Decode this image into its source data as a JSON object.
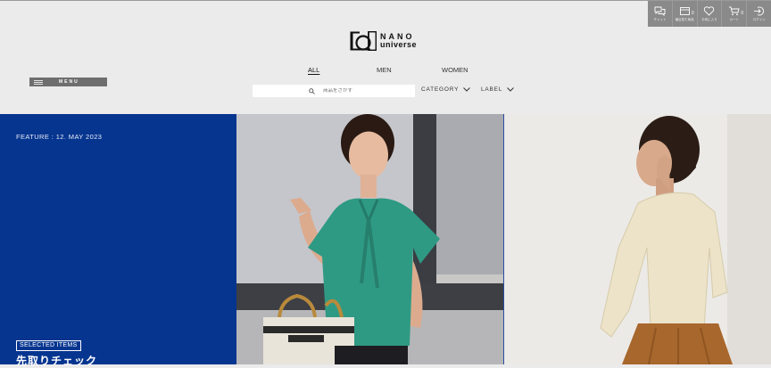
{
  "brand": {
    "line1": "NANO",
    "line2": "universe"
  },
  "utility": [
    {
      "icon": "chat-icon",
      "label": "チャット",
      "count": ""
    },
    {
      "icon": "browsing-history-icon",
      "label": "最近見た商品",
      "count": "0"
    },
    {
      "icon": "heart-icon",
      "label": "お気に入り",
      "count": ""
    },
    {
      "icon": "cart-icon",
      "label": "カート",
      "count": "0"
    },
    {
      "icon": "login-icon",
      "label": "ログイン",
      "count": ""
    }
  ],
  "menu": {
    "label": "MENU"
  },
  "nav": {
    "all": "ALL",
    "men": "MEN",
    "women": "WOMEN"
  },
  "search": {
    "placeholder": "商品をさがす"
  },
  "filters": {
    "category": "CATEGORY",
    "label": "LABEL"
  },
  "feature": {
    "date": "FEATURE : 12. MAY 2023",
    "badge": "SELECTED ITEMS",
    "title": "先取りチェック"
  },
  "colors": {
    "feature_bg": "#063590",
    "header_bg": "#ebebec",
    "utility_bg": "#8a8a8a"
  }
}
